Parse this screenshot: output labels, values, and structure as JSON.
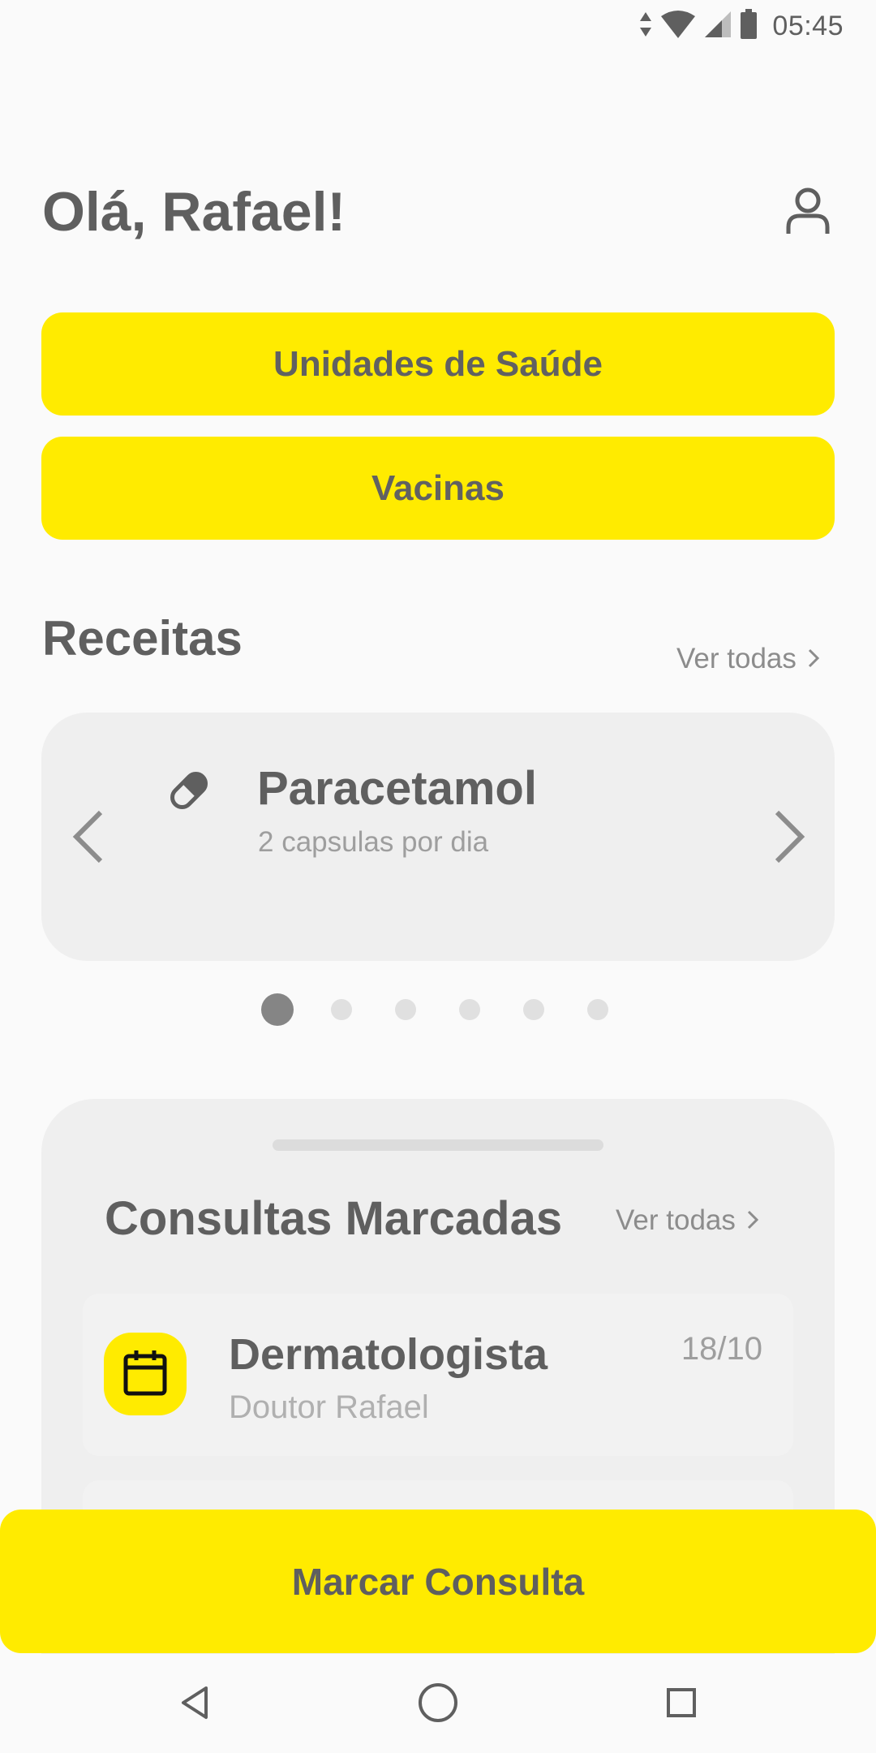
{
  "status_bar": {
    "time": "05:45",
    "icons": [
      "data-arrows-icon",
      "wifi-icon",
      "signal-icon",
      "battery-icon"
    ]
  },
  "header": {
    "greeting": "Olá, Rafael!",
    "profile_icon": "person-icon"
  },
  "quick_actions": {
    "unidades_label": "Unidades de Saúde",
    "vacinas_label": "Vacinas"
  },
  "receitas": {
    "title": "Receitas",
    "see_all": "Ver todas",
    "current": {
      "name": "Paracetamol",
      "dosage": "2 capsulas por dia",
      "icon": "pill-icon"
    },
    "page_count": 6,
    "active_page": 1
  },
  "consultas": {
    "title": "Consultas Marcadas",
    "see_all": "Ver todas",
    "items": [
      {
        "specialty": "Dermatologista",
        "doctor": "Doutor Rafael",
        "date": "18/10",
        "icon": "calendar-icon"
      }
    ]
  },
  "cta": {
    "label": "Marcar Consulta"
  },
  "nav_bar": {
    "icons": [
      "back-icon",
      "home-icon",
      "recents-icon"
    ]
  },
  "colors": {
    "accent": "#ffeb00",
    "background": "#fafafa",
    "card": "#efefef",
    "text_primary": "#5f5f5f",
    "text_secondary": "#9e9e9e"
  }
}
